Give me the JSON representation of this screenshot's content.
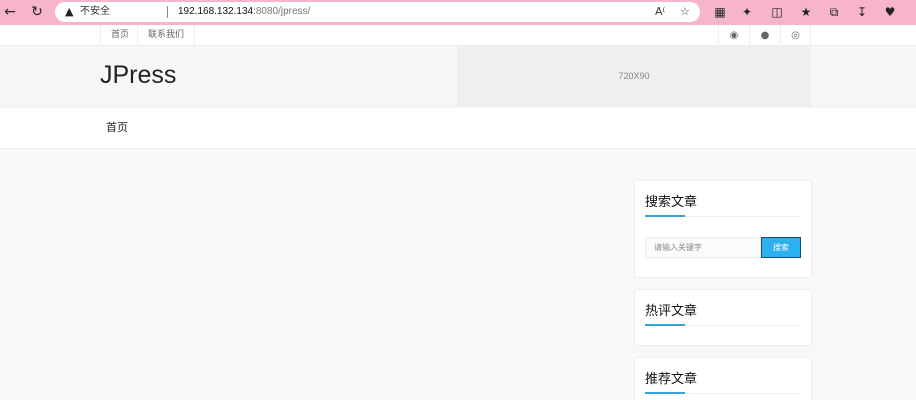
{
  "browser": {
    "security_label": "不安全",
    "url_host": "192.168.132.134",
    "url_rest": ":8080/jpress/",
    "nav_icons": [
      "back-icon",
      "reload-icon"
    ],
    "toolbar_icons": [
      "read-aloud-icon",
      "favorite-star-icon",
      "apps-icon",
      "extensions-icon",
      "split-screen-icon",
      "favorites-icon",
      "collections-icon",
      "downloads-icon",
      "performance-icon"
    ]
  },
  "topbar": {
    "links": [
      "首页",
      "联系我们"
    ],
    "social_icons": [
      "wechat-icon",
      "qq-icon",
      "weibo-icon"
    ]
  },
  "header": {
    "logo": "JPress",
    "ad_text": "720X90"
  },
  "menu": {
    "items": [
      "首页"
    ]
  },
  "sidebar": {
    "search": {
      "title": "搜索文章",
      "placeholder": "请输入关键字",
      "button": "搜索"
    },
    "hot": {
      "title": "热评文章"
    },
    "recommend": {
      "title": "推荐文章"
    }
  },
  "colors": {
    "chrome": "#f6b5cc",
    "accent": "#38a3d9",
    "search_button": "#2bb1ef"
  }
}
